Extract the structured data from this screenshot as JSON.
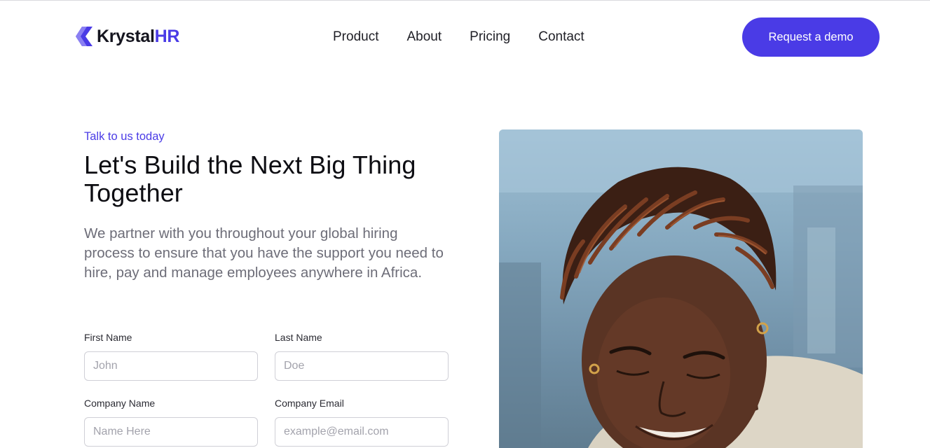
{
  "header": {
    "logo": {
      "name_part1": "Krystal",
      "name_part2": "HR",
      "brand_color": "#4a3be6",
      "icon": "krystal-logo-icon"
    },
    "nav": [
      "Product",
      "About",
      "Pricing",
      "Contact"
    ],
    "cta_label": "Request a demo"
  },
  "hero": {
    "eyebrow": "Talk to us today",
    "headline": "Let's Build the Next Big Thing Together",
    "lead": "We partner with you throughout your global hiring process to ensure that you have the support you need to hire, pay and manage employees anywhere in Africa."
  },
  "form": {
    "first_name": {
      "label": "First Name",
      "placeholder": "John",
      "value": ""
    },
    "last_name": {
      "label": "Last Name",
      "placeholder": "Doe",
      "value": ""
    },
    "company_name": {
      "label": "Company Name",
      "placeholder": "Name Here",
      "value": ""
    },
    "company_email": {
      "label": "Company Email",
      "placeholder": "example@email.com",
      "value": ""
    }
  },
  "colors": {
    "accent": "#4a3be6",
    "text": "#0d0d12",
    "muted": "#6d6d78",
    "border": "#cfcfd6"
  }
}
